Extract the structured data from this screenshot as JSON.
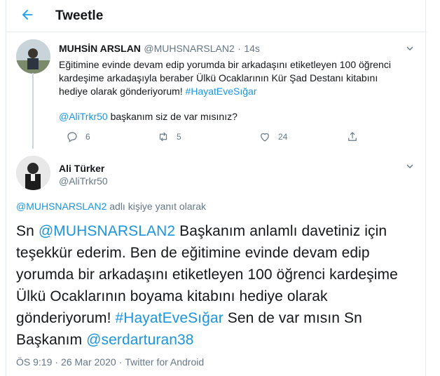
{
  "header": {
    "title": "Tweetle",
    "back_icon": "back-arrow-icon"
  },
  "parent_tweet": {
    "author_name": "MUHSİN ARSLAN",
    "author_handle": "@MUHSNARSLAN2",
    "separator": "·",
    "time": "14s",
    "text_line1": "Eğitimine evinde devam edip yorumda bir arkadaşını etiketleyen 100 öğrenci",
    "text_line2": "kardeşime arkadaşıyla beraber Ülkü Ocaklarının Kür Şad Destanı kitabını",
    "text_line3_pre": "hediye olarak gönderiyorum! ",
    "hashtag": "#HayatEveSığar",
    "mention": "@AliTrkr50",
    "text_after_mention": " başkanım siz de var mısınız?",
    "reply_count": "6",
    "retweet_count": "5",
    "like_count": "24"
  },
  "reply_tweet": {
    "author_name": "Ali Türker",
    "author_handle": "@AliTrkr50",
    "replying_to_mention": "@MUHSNARSLAN2",
    "replying_to_suffix": " adlı kişiye yanıt olarak",
    "text_pre": "Sn ",
    "mention1": "@MUHSNARSLAN2",
    "text_mid": " Başkanım anlamlı davetiniz için teşekkür ederim. Ben de eğitimine evinde devam edip yorumda bir arkadaşını etiketleyen 100 öğrenci kardeşime  Ülkü Ocaklarının boyama kitabını hediye olarak gönderiyorum! ",
    "hashtag": " #HayatEveSığar",
    "text_post": " Sen de var mısın Sn Başkanım ",
    "mention2": "@serdarturan38",
    "time": "ÖS 9:19",
    "sep": "·",
    "date": "26 Mar 2020",
    "source": "Twitter for Android"
  },
  "colors": {
    "accent": "#1da1f2",
    "link": "#1b95e0",
    "muted": "#657786",
    "border": "#e6ecf0"
  }
}
